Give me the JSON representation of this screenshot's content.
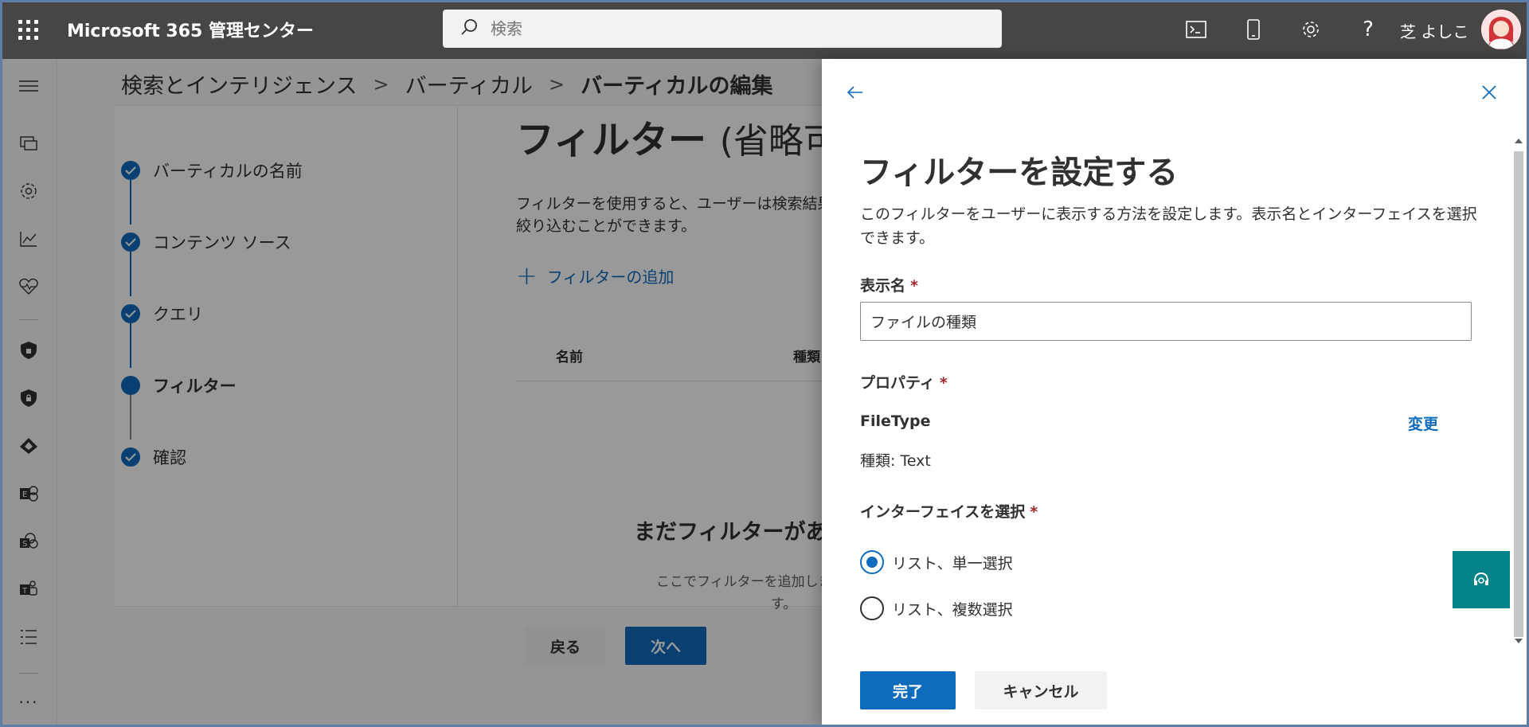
{
  "header": {
    "app_title": "Microsoft 365 管理センター",
    "search_placeholder": "検索",
    "user_name": "芝 よしこ"
  },
  "breadcrumb": {
    "items": [
      "検索とインテリジェンス",
      "バーティカル"
    ],
    "current": "バーティカルの編集"
  },
  "steps": [
    {
      "label": "バーティカルの名前",
      "state": "done"
    },
    {
      "label": "コンテンツ ソース",
      "state": "done"
    },
    {
      "label": "クエリ",
      "state": "done"
    },
    {
      "label": "フィルター",
      "state": "current"
    },
    {
      "label": "確認",
      "state": "done"
    }
  ],
  "main": {
    "title": "フィルター",
    "title_optional": "(省略可",
    "description": "フィルターを使用すると、ユーザーは検索結果を絞り込むことができます。",
    "add_filter": "フィルターの追加",
    "col_name": "名前",
    "col_type": "種類",
    "empty_title": "まだフィルターがあ",
    "empty_desc": "ここでフィルターを追加しま",
    "empty_desc2": "す。",
    "back_button": "戻る",
    "next_button": "次へ"
  },
  "panel": {
    "title": "フィルターを設定する",
    "description": "このフィルターをユーザーに表示する方法を設定します。表示名とインターフェイスを選択できます。",
    "display_name_label": "表示名",
    "display_name_value": "ファイルの種類",
    "property_label": "プロパティ",
    "property_name": "FileType",
    "change_link": "変更",
    "property_type": "種類: Text",
    "interface_label": "インターフェイスを選択",
    "required_mark": "*",
    "options": [
      {
        "label": "リスト、単一選択",
        "checked": true
      },
      {
        "label": "リスト、複数選択",
        "checked": false
      }
    ],
    "done_button": "完了",
    "cancel_button": "キャンセル"
  },
  "colors": {
    "accent": "#0f6cbd",
    "header_bg": "#484644",
    "help_bg": "#038387",
    "required": "#a4262c"
  }
}
